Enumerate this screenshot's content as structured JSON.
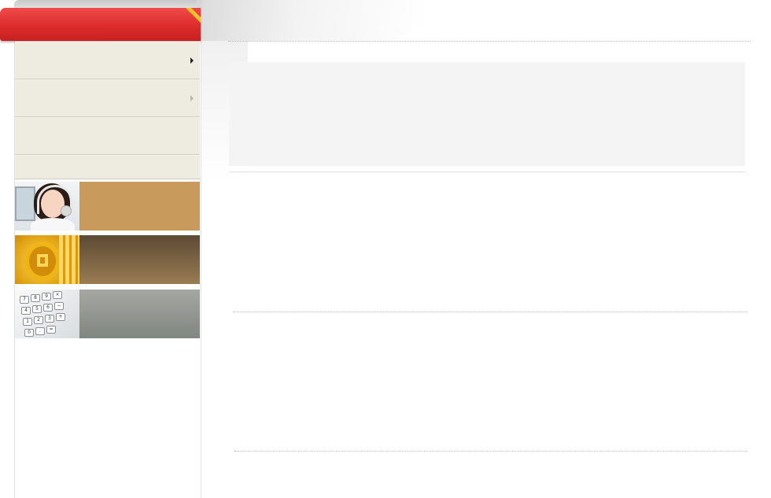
{
  "sidebar": {
    "header": {
      "title": ""
    },
    "nav_items": [
      {
        "label": "",
        "arrow": "caret-right-icon",
        "arrow_state": "active"
      },
      {
        "label": "",
        "arrow": "caret-right-icon",
        "arrow_state": "muted"
      },
      {
        "label": ""
      },
      {
        "label": ""
      }
    ],
    "banners": [
      {
        "label": "",
        "image": "customer-service-agent-photo",
        "color": "#c89a5b"
      },
      {
        "label": "",
        "image": "gold-coin-photo",
        "color": "#6a5536"
      },
      {
        "label": "",
        "image": "calculator-keypad-photo",
        "color": "#8d908c"
      }
    ]
  },
  "main": {
    "content_box": {
      "text": ""
    },
    "sections": [
      {
        "text": ""
      },
      {
        "text": ""
      }
    ]
  },
  "colors": {
    "header_red": "#e03232",
    "ribbon_gold": "#f3c229",
    "nav_bg": "#eeebe1",
    "content_bg": "#f4f4f4"
  }
}
